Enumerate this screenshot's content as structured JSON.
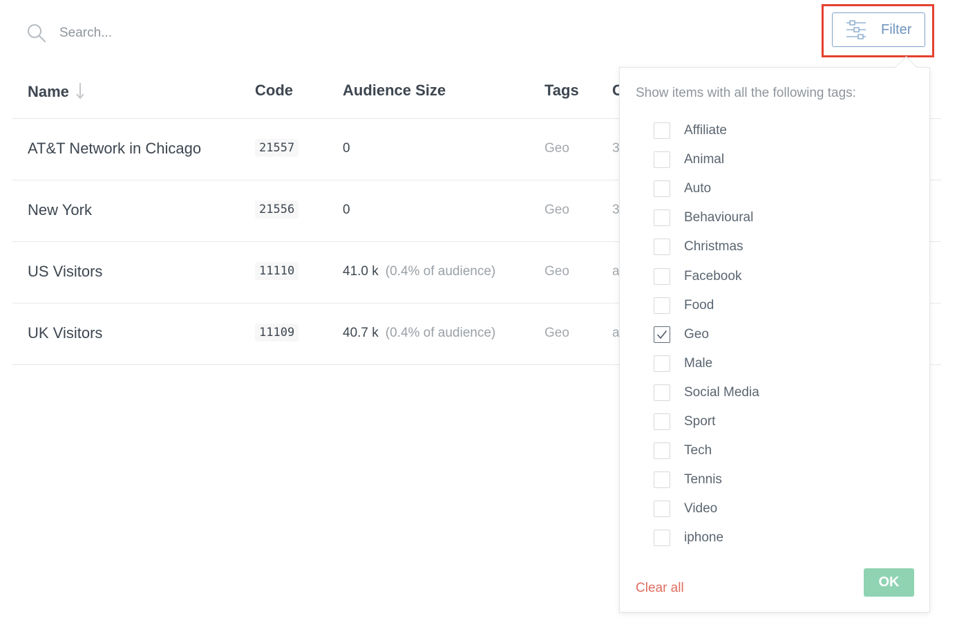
{
  "search": {
    "placeholder": "Search...",
    "icon": "search-icon"
  },
  "filter_button": {
    "label": "Filter",
    "icon": "sliders-icon"
  },
  "table": {
    "headers": {
      "name": "Name",
      "code": "Code",
      "audience": "Audience Size",
      "tags": "Tags",
      "extra": "C"
    },
    "rows": [
      {
        "name": "AT&T Network in Chicago",
        "code": "21557",
        "audience": "0",
        "percent": "",
        "tags": "Geo",
        "extra": "3"
      },
      {
        "name": "New York",
        "code": "21556",
        "audience": "0",
        "percent": "",
        "tags": "Geo",
        "extra": "3"
      },
      {
        "name": "US Visitors",
        "code": "11110",
        "audience": "41.0 k",
        "percent": "(0.4% of audience)",
        "tags": "Geo",
        "extra": "a"
      },
      {
        "name": "UK Visitors",
        "code": "11109",
        "audience": "40.7 k",
        "percent": "(0.4% of audience)",
        "tags": "Geo",
        "extra": "a"
      }
    ]
  },
  "filter_panel": {
    "title": "Show items with all the following tags:",
    "tags": [
      {
        "label": "Affiliate",
        "checked": false
      },
      {
        "label": "Animal",
        "checked": false
      },
      {
        "label": "Auto",
        "checked": false
      },
      {
        "label": "Behavioural",
        "checked": false
      },
      {
        "label": "Christmas",
        "checked": false
      },
      {
        "label": "Facebook",
        "checked": false
      },
      {
        "label": "Food",
        "checked": false
      },
      {
        "label": "Geo",
        "checked": true
      },
      {
        "label": "Male",
        "checked": false
      },
      {
        "label": "Social Media",
        "checked": false
      },
      {
        "label": "Sport",
        "checked": false
      },
      {
        "label": "Tech",
        "checked": false
      },
      {
        "label": "Tennis",
        "checked": false
      },
      {
        "label": "Video",
        "checked": false
      },
      {
        "label": "iphone",
        "checked": false
      }
    ],
    "clear_label": "Clear all",
    "ok_label": "OK"
  },
  "colors": {
    "highlight": "#e4412f",
    "filter_accent": "#6f95bd",
    "ok_button": "#8fd3b2",
    "clear_link": "#e06d5f"
  }
}
